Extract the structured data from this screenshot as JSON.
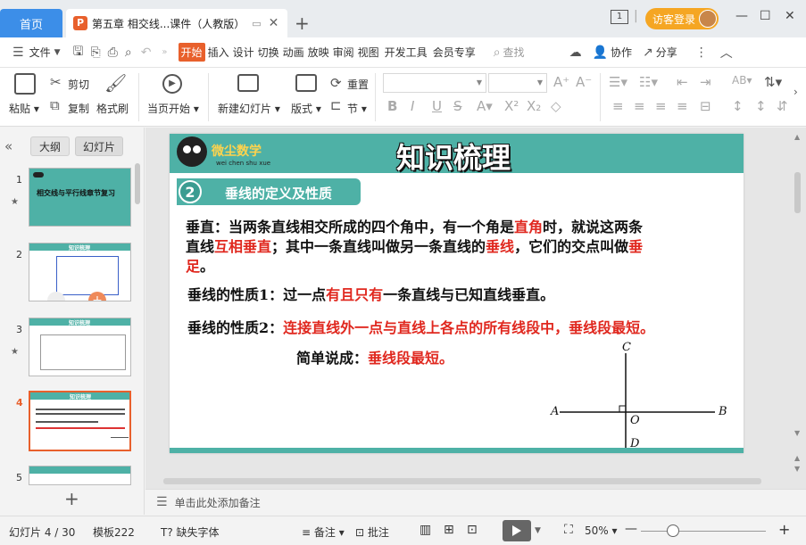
{
  "tabs": {
    "home": "首页",
    "doc_title": "第五章 相交线...课件（人教版）",
    "doc_icon": "P"
  },
  "window": {
    "page_badge": "1",
    "login": "访客登录"
  },
  "menu": {
    "file": "文件",
    "items": [
      "开始",
      "插入",
      "设计",
      "切换",
      "动画",
      "放映",
      "审阅",
      "视图",
      "开发工具",
      "会员专享"
    ],
    "search": "查找",
    "collab": "协作",
    "share": "分享"
  },
  "ribbon": {
    "paste": "粘贴",
    "cut": "剪切",
    "copy": "复制",
    "format_painter": "格式刷",
    "from_current": "当页开始",
    "new_slide": "新建幻灯片",
    "layout": "版式",
    "reset": "重置",
    "section": "节"
  },
  "leftpanel": {
    "outline": "大纲",
    "slides": "幻灯片",
    "thumb_titles": [
      "相交线与平行线章节复习",
      "知识梳理",
      "知识梳理",
      "知识梳理",
      ""
    ],
    "thumb_numbers": [
      "1",
      "2",
      "3",
      "4",
      "5"
    ]
  },
  "slide": {
    "brand": "微尘数学",
    "brand_sub": "wei chen shu xue",
    "title": "知识梳理",
    "section_num": "2",
    "section_label": "垂线的定义及性质",
    "p1_a": "垂直：当两条直线相交所成的四个角中，有一个角是",
    "p1_red1": "直角",
    "p1_b": "时，就说这两条",
    "p2_a": "直线",
    "p2_red1": "互相垂直",
    "p2_b": "；其中一条直线叫做另一条直线的",
    "p2_red2": "垂线",
    "p2_c": "，它们的交点叫做",
    "p2_red3": "垂",
    "p3_red": "足",
    "p3_b": "。",
    "prop1_a": "垂线的性质1：过一点",
    "prop1_red": "有且只有",
    "prop1_b": "一条直线与已知直线垂直。",
    "prop2_a": "垂线的性质2：",
    "prop2_red": "连接直线外一点与直线上各点的所有线段中，垂线段最短。",
    "simple_a": "简单说成：",
    "simple_red": "垂线段最短。",
    "fig": {
      "A": "A",
      "B": "B",
      "C": "C",
      "D": "D",
      "O": "O"
    }
  },
  "notes": "单击此处添加备注",
  "status": {
    "slide_pos": "幻灯片 4 / 30",
    "template": "模板222",
    "missing_font": "缺失字体",
    "notes_btn": "备注",
    "comment_btn": "批注",
    "zoom": "50%"
  },
  "colors": {
    "accent": "#e8602c",
    "teal": "#4eb1a6",
    "red_text": "#e0281f",
    "home_tab": "#3c8ee8",
    "login": "#f5a623"
  }
}
